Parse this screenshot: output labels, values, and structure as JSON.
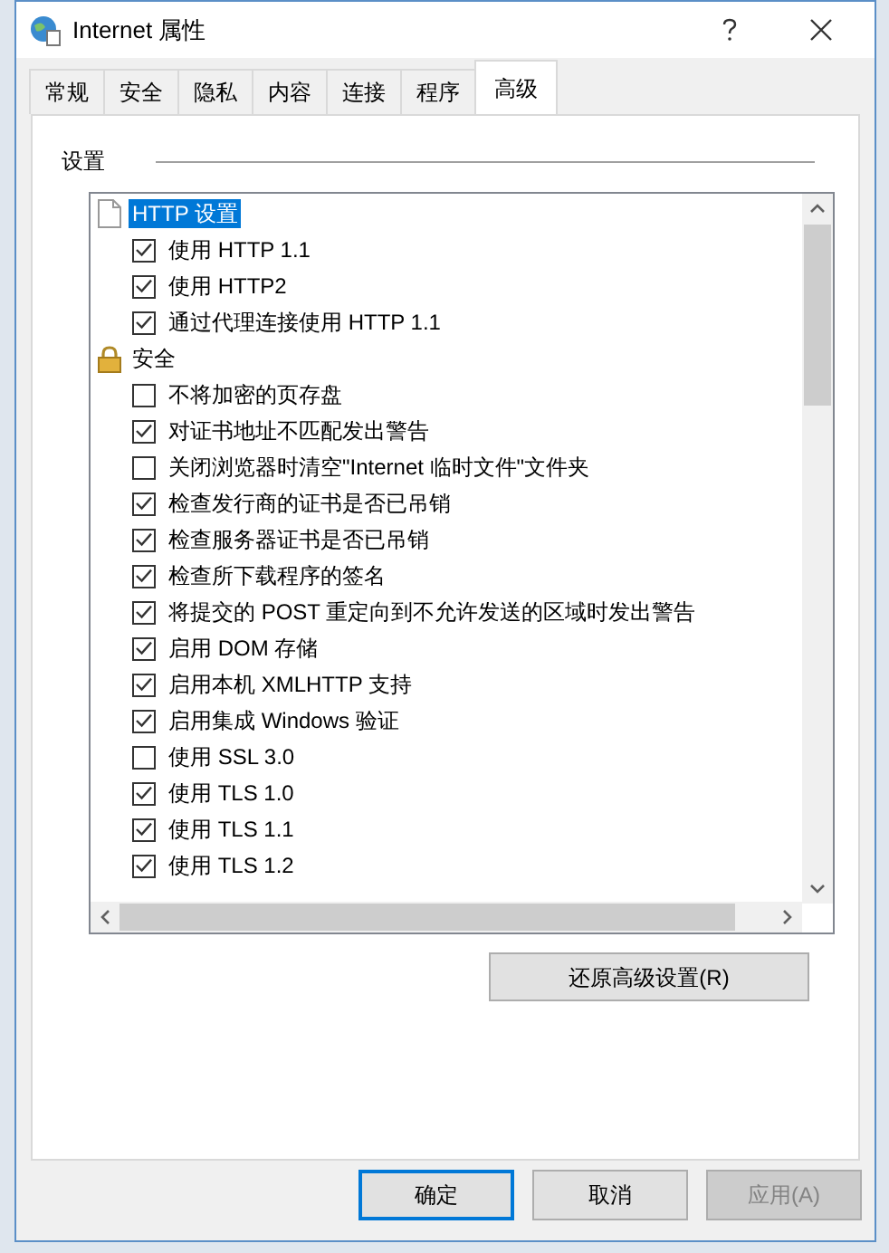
{
  "window": {
    "title": "Internet 属性"
  },
  "tabs": [
    {
      "label": "常规",
      "selected": false
    },
    {
      "label": "安全",
      "selected": false
    },
    {
      "label": "隐私",
      "selected": false
    },
    {
      "label": "内容",
      "selected": false
    },
    {
      "label": "连接",
      "selected": false
    },
    {
      "label": "程序",
      "selected": false
    },
    {
      "label": "高级",
      "selected": true
    }
  ],
  "settings": {
    "heading": "设置",
    "groups": [
      {
        "label": "HTTP 设置",
        "selected": true,
        "children": [
          {
            "label": "使用 HTTP 1.1",
            "checked": true,
            "selected": false
          },
          {
            "label": "使用 HTTP2",
            "checked": true,
            "selected": false
          },
          {
            "label": "通过代理连接使用 HTTP 1.1",
            "checked": true,
            "selected": false
          }
        ]
      },
      {
        "label": "安全",
        "selected": false,
        "children": [
          {
            "label": "不将加密的页存盘",
            "checked": false,
            "selected": false
          },
          {
            "label": "对证书地址不匹配发出警告",
            "checked": true,
            "selected": false
          },
          {
            "label": "关闭浏览器时清空\"Internet 临时文件\"文件夹",
            "checked": false,
            "selected": false
          },
          {
            "label": "检查发行商的证书是否已吊销",
            "checked": true,
            "selected": false
          },
          {
            "label": "检查服务器证书是否已吊销",
            "checked": true,
            "selected": false
          },
          {
            "label": "检查所下载程序的签名",
            "checked": true,
            "selected": false
          },
          {
            "label": "将提交的 POST 重定向到不允许发送的区域时发出警告",
            "checked": true,
            "selected": false
          },
          {
            "label": "启用 DOM 存储",
            "checked": true,
            "selected": false
          },
          {
            "label": "启用本机 XMLHTTP 支持",
            "checked": true,
            "selected": false
          },
          {
            "label": "启用集成 Windows 验证",
            "checked": true,
            "selected": false
          },
          {
            "label": "使用 SSL 3.0",
            "checked": false,
            "selected": false
          },
          {
            "label": "使用 TLS 1.0",
            "checked": true,
            "selected": false
          },
          {
            "label": "使用 TLS 1.1",
            "checked": true,
            "selected": false
          },
          {
            "label": "使用 TLS 1.2",
            "checked": true,
            "selected": false
          }
        ]
      }
    ]
  },
  "reset_button": "还原高级设置(R)",
  "buttons": [
    {
      "label": "确定",
      "kind": "default",
      "disabled": false
    },
    {
      "label": "取消",
      "kind": "normal",
      "disabled": false
    },
    {
      "label": "应用(A)",
      "kind": "normal",
      "disabled": true
    }
  ]
}
